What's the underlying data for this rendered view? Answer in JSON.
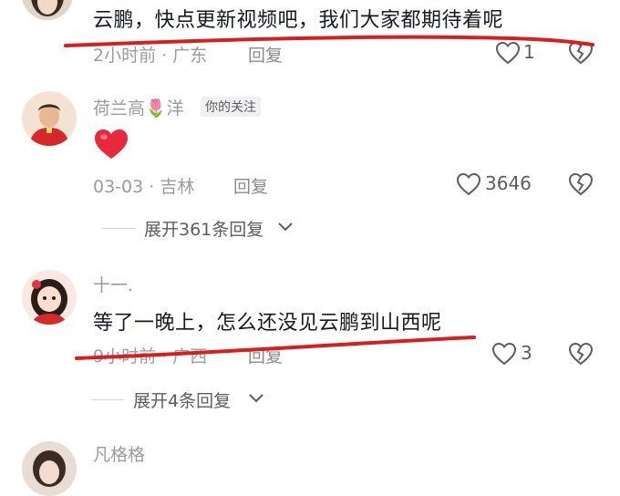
{
  "comments": [
    {
      "text": "云鹏，快点更新视频吧，我们大家都期待着呢",
      "meta": "2小时前 · 广东",
      "reply_label": "回复",
      "likes": "1"
    },
    {
      "username": "荷兰高🌷洋",
      "badge": "你的关注",
      "text": "❤",
      "meta": "03-03 · 吉林",
      "reply_label": "回复",
      "likes": "3646",
      "expand": "展开361条回复"
    },
    {
      "username": "十一.",
      "text": "等了一晚上，怎么还没见云鹏到山西呢",
      "meta": "9小时前 · 广西",
      "reply_label": "回复",
      "likes": "3",
      "expand": "展开4条回复"
    },
    {
      "username": "凡格格"
    }
  ],
  "colors": {
    "underline": "#d81e1e",
    "text": "#161823",
    "meta": "#9a9ba0"
  }
}
